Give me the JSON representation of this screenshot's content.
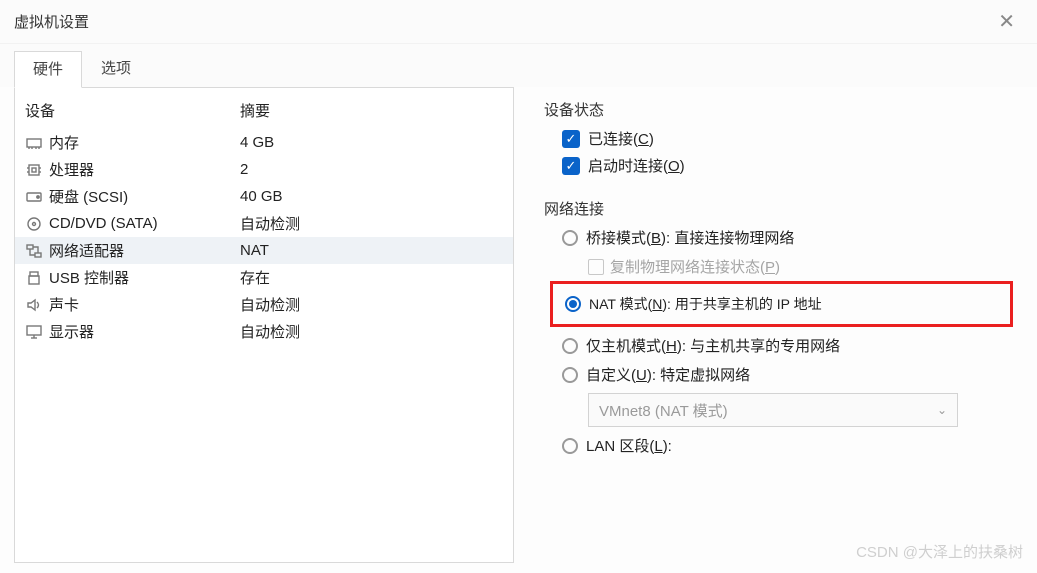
{
  "window": {
    "title": "虚拟机设置"
  },
  "tabs": {
    "hardware": "硬件",
    "options": "选项",
    "active": "hardware"
  },
  "device_table": {
    "header_device": "设备",
    "header_summary": "摘要",
    "rows": [
      {
        "id": "memory",
        "label": "内存",
        "summary": "4 GB",
        "icon": "memory-icon"
      },
      {
        "id": "processor",
        "label": "处理器",
        "summary": "2",
        "icon": "cpu-icon"
      },
      {
        "id": "disk",
        "label": "硬盘 (SCSI)",
        "summary": "40 GB",
        "icon": "disk-icon"
      },
      {
        "id": "cddvd",
        "label": "CD/DVD (SATA)",
        "summary": "自动检测",
        "icon": "cd-icon"
      },
      {
        "id": "network",
        "label": "网络适配器",
        "summary": "NAT",
        "icon": "network-icon",
        "selected": true
      },
      {
        "id": "usb",
        "label": "USB 控制器",
        "summary": "存在",
        "icon": "usb-icon"
      },
      {
        "id": "sound",
        "label": "声卡",
        "summary": "自动检测",
        "icon": "sound-icon"
      },
      {
        "id": "display",
        "label": "显示器",
        "summary": "自动检测",
        "icon": "display-icon"
      }
    ]
  },
  "device_status": {
    "group_label": "设备状态",
    "connected_label": "已连接(",
    "connected_key": "C",
    "connected_suffix": ")",
    "connect_at_poweron_label": "启动时连接(",
    "connect_at_poweron_key": "O",
    "connect_at_poweron_suffix": ")"
  },
  "network": {
    "group_label": "网络连接",
    "bridged_label": "桥接模式(",
    "bridged_key": "B",
    "bridged_suffix": "): 直接连接物理网络",
    "replicate_label": "复制物理网络连接状态(",
    "replicate_key": "P",
    "replicate_suffix": ")",
    "nat_label": "NAT 模式(",
    "nat_key": "N",
    "nat_suffix": "): 用于共享主机的 IP 地址",
    "hostonly_label": "仅主机模式(",
    "hostonly_key": "H",
    "hostonly_suffix": "): 与主机共享的专用网络",
    "custom_label": "自定义(",
    "custom_key": "U",
    "custom_suffix": "): 特定虚拟网络",
    "custom_value": "VMnet8 (NAT 模式)",
    "lan_label": "LAN 区段(",
    "lan_key": "L",
    "lan_suffix": "):"
  },
  "watermark": "CSDN @大泽上的扶桑树"
}
